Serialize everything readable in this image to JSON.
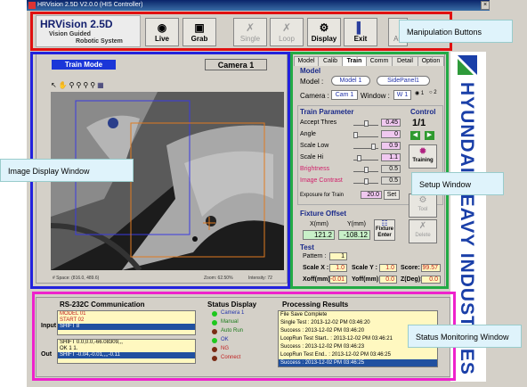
{
  "window": {
    "title": "HRVision 2.5D  V2.0.0 (HIS Controller)"
  },
  "app": {
    "name": "HRVision 2.5D",
    "subtitle1": "Vision Guided",
    "subtitle2": "Robotic System"
  },
  "toolbar": {
    "live": "Live",
    "grab": "Grab",
    "single": "Single",
    "loop": "Loop",
    "display": "Display",
    "exit": "Exit",
    "auto": "Au"
  },
  "callouts": {
    "manipulation": "Manipulation Buttons",
    "image_display": "Image Display Window",
    "setup": "Setup Window",
    "status": "Status Monitoring Window"
  },
  "image_window": {
    "mode": "Train Mode",
    "camera": "Camera 1",
    "status_space": "# Space: (816.0, 489.6)",
    "zoom": "Zoom: 62.50%",
    "intensity": "Intensity: 72"
  },
  "tabs": [
    "Model",
    "Calib",
    "Train",
    "Comm",
    "Detail",
    "Option"
  ],
  "setup": {
    "model_header": "Model",
    "model_label": "Model :",
    "model_value": "Model 1",
    "model_part": "SidePanel1",
    "camera_label": "Camera :",
    "camera_value": "Cam 1",
    "window_label": "Window :",
    "window_value": "W 1",
    "radio1": "1",
    "radio2": "2",
    "train_param_header": "Train Parameter",
    "control_header": "Control",
    "params": [
      {
        "label": "Accept Thres",
        "value": "0.45"
      },
      {
        "label": "Angle",
        "value": "0"
      },
      {
        "label": "Scale Low",
        "value": "0.9"
      },
      {
        "label": "Scale Hi",
        "value": "1.1"
      },
      {
        "label": "Brightness",
        "value": "0.5"
      },
      {
        "label": "Image Contrast",
        "value": "0.5"
      }
    ],
    "exposure_label": "Exposure for Train",
    "exposure_value": "20.0",
    "set_label": "Set",
    "control_value": "1/1",
    "training_label": "Training",
    "tool_label": "Tool",
    "delete_label": "Delete",
    "fixture_header": "Fixture Offset",
    "x_label": "X(mm)",
    "y_label": "Y(mm)",
    "x_value": "121.2",
    "y_value": "-108.12",
    "fixture_btn": "Fixture Enter",
    "test_header": "Test",
    "pattern_label": "Pattern :",
    "pattern_value": "1",
    "scalex_label": "Scale X :",
    "scalex_value": "1.0",
    "scaley_label": "Scale Y :",
    "scaley_value": "1.0",
    "score_label": "Score:",
    "score_value": "99.57",
    "xoff_label": "Xoff(mm):",
    "xoff_value": "-0.01",
    "yoff_label": "Yoff(mm):",
    "yoff_value": "0.0",
    "zdeg_label": "Z(Deg):",
    "zdeg_value": "0.0"
  },
  "brand": "HYUNDAI HEAVY INDUSTRIES",
  "status": {
    "rs232_header": "RS-232C Communication",
    "input_label": "Input",
    "out_label": "Out",
    "input_lines": [
      "MODEL 01",
      "START 02",
      "SHIFT 8"
    ],
    "out_lines": [
      "SHIFT 0.0,0.0,-66.08309,,,",
      "OK 1 1.",
      "SHIFT -0.04,-0.01,,,,-0.11"
    ],
    "display_header": "Status Display",
    "indicators": [
      {
        "label": "Camera 1",
        "color": "#1ec81e"
      },
      {
        "label": "Manual",
        "color": "#1ec81e"
      },
      {
        "label": "Auto Run",
        "color": "#7a2a14"
      },
      {
        "label": "OK",
        "color": "#1ec81e"
      },
      {
        "label": "NG",
        "color": "#7a2a14"
      },
      {
        "label": "Connect",
        "color": "#7a2a14"
      }
    ],
    "results_header": "Processing Results",
    "results": [
      "File Save Complete",
      "Single Test : 2013-12-02 PM 03:46:20",
      "Success : 2013-12-02 PM 03:46:20",
      "LoopRun Test Start.. : 2013-12-02 PM 03:46:21",
      "Success : 2013-12-02 PM 03:46:23",
      "LoopRun Test End.. : 2013-12-02 PM 03:46:25",
      "Success : 2013-12-02 PM 03:46:25"
    ]
  },
  "colors": {
    "red_frame": "#e01010",
    "blue_frame": "#2222dd",
    "green_frame": "#22aa44",
    "magenta_frame": "#ee22cc",
    "brand": "#1a3fa8"
  }
}
